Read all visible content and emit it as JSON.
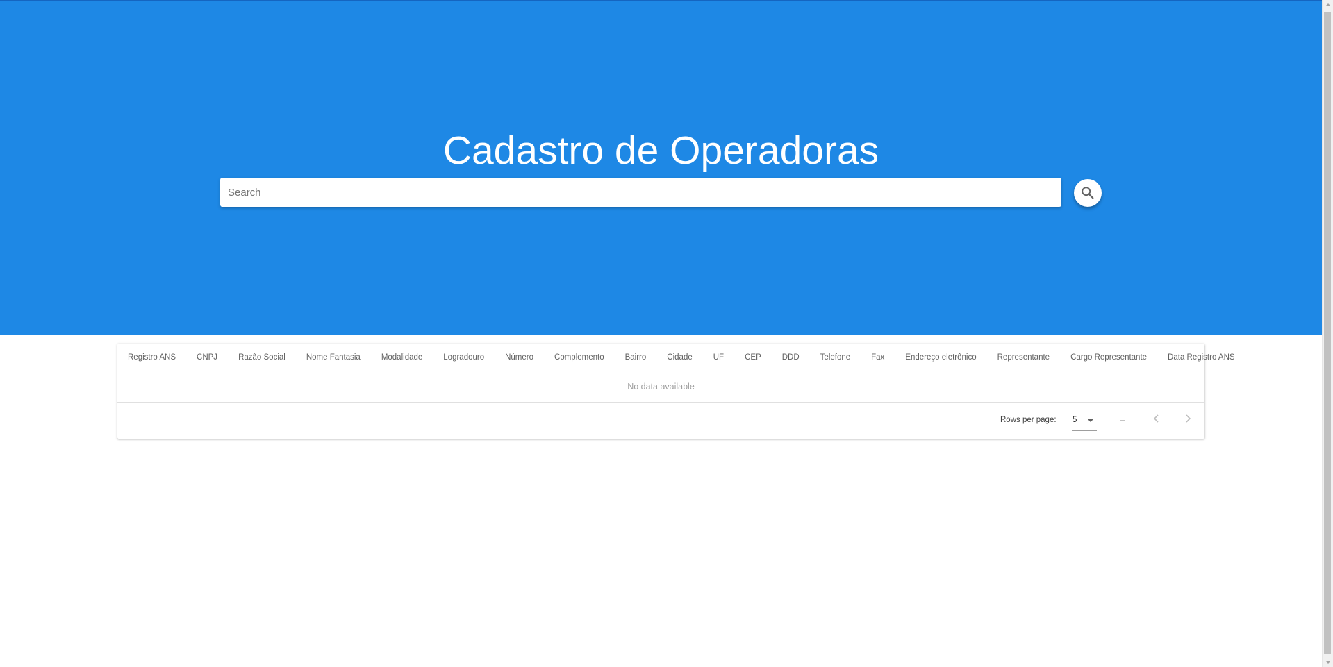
{
  "header": {
    "title": "Cadastro de Operadoras",
    "search_placeholder": "Search",
    "search_value": "",
    "search_button_icon": "search-icon"
  },
  "table": {
    "columns": [
      "Registro ANS",
      "CNPJ",
      "Razão Social",
      "Nome Fantasia",
      "Modalidade",
      "Logradouro",
      "Número",
      "Complemento",
      "Bairro",
      "Cidade",
      "UF",
      "CEP",
      "DDD",
      "Telefone",
      "Fax",
      "Endereço eletrônico",
      "Representante",
      "Cargo Representante",
      "Data Registro ANS"
    ],
    "empty_text": "No data available",
    "footer": {
      "rows_per_page_label": "Rows per page:",
      "rows_per_page_value": "5",
      "range_text": "–",
      "prev_icon": "chevron-left-icon",
      "next_icon": "chevron-right-icon"
    }
  },
  "colors": {
    "primary": "#1e88e5",
    "header_text": "#ffffff"
  }
}
